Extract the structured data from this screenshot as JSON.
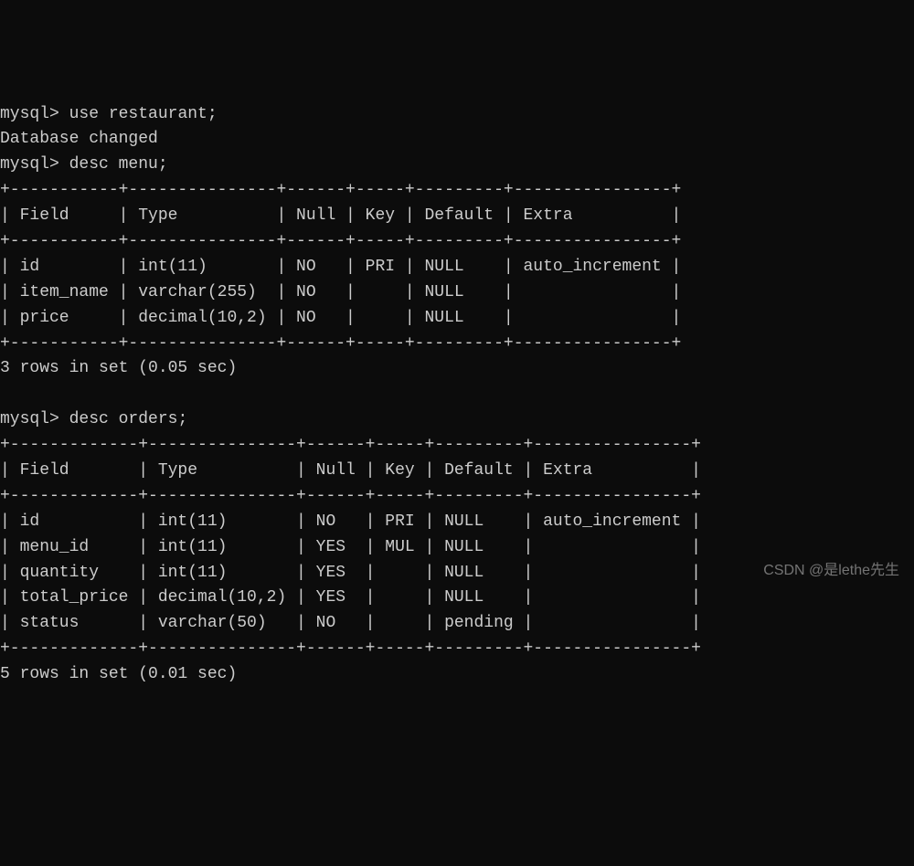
{
  "terminal": {
    "prompt": "mysql>",
    "commands": {
      "use_db": "use restaurant;",
      "use_db_response": "Database changed",
      "desc_menu": "desc menu;",
      "desc_orders": "desc orders;"
    },
    "tables": {
      "menu": {
        "border_top": "+-----------+---------------+------+-----+---------+----------------+",
        "header_row": "| Field     | Type          | Null | Key | Default | Extra          |",
        "border_mid": "+-----------+---------------+------+-----+---------+----------------+",
        "rows": [
          "| id        | int(11)       | NO   | PRI | NULL    | auto_increment |",
          "| item_name | varchar(255)  | NO   |     | NULL    |                |",
          "| price     | decimal(10,2) | NO   |     | NULL    |                |"
        ],
        "border_bot": "+-----------+---------------+------+-----+---------+----------------+",
        "summary": "3 rows in set (0.05 sec)"
      },
      "orders": {
        "border_top": "+-------------+---------------+------+-----+---------+----------------+",
        "header_row": "| Field       | Type          | Null | Key | Default | Extra          |",
        "border_mid": "+-------------+---------------+------+-----+---------+----------------+",
        "rows": [
          "| id          | int(11)       | NO   | PRI | NULL    | auto_increment |",
          "| menu_id     | int(11)       | YES  | MUL | NULL    |                |",
          "| quantity    | int(11)       | YES  |     | NULL    |                |",
          "| total_price | decimal(10,2) | YES  |     | NULL    |                |",
          "| status      | varchar(50)   | NO   |     | pending |                |"
        ],
        "border_bot": "+-------------+---------------+------+-----+---------+----------------+",
        "summary": "5 rows in set (0.01 sec)"
      }
    }
  },
  "watermark": "CSDN @是lethe先生"
}
